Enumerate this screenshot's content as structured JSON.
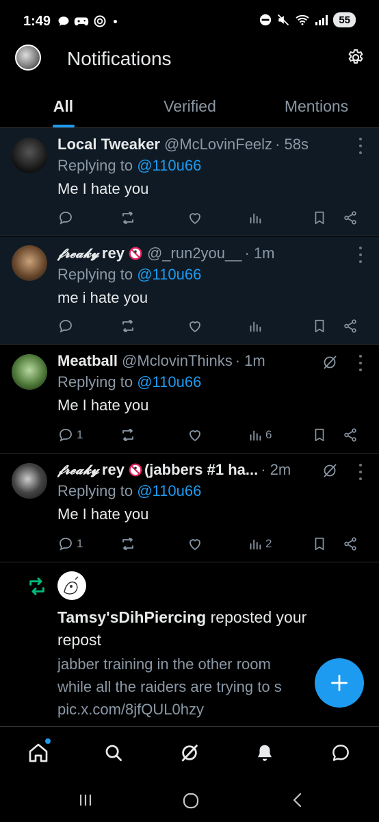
{
  "status_bar": {
    "time": "1:49",
    "battery": "55"
  },
  "header": {
    "title": "Notifications"
  },
  "tabs": [
    {
      "label": "All",
      "active": true
    },
    {
      "label": "Verified",
      "active": false
    },
    {
      "label": "Mentions",
      "active": false
    }
  ],
  "notifications": [
    {
      "name": "Local Tweaker",
      "handle": "@McLovinFeelz",
      "time": "· 58s",
      "replying_prefix": "Replying to",
      "replying_to": "@110u66",
      "text": "Me I hate you",
      "replies": "",
      "views": ""
    },
    {
      "name_styled": "𝓯𝓻𝓮𝓪𝓴𝔂",
      "name": "rey",
      "handle": "@_run2you__",
      "time": "· 1m",
      "replying_prefix": "Replying to",
      "replying_to": "@110u66",
      "text": "me i hate you",
      "replies": "",
      "views": ""
    },
    {
      "name": "Meatball",
      "handle": "@MclovinThinks",
      "time": "· 1m",
      "replying_prefix": "Replying to",
      "replying_to": "@110u66",
      "text": "Me I hate you",
      "replies": "1",
      "views": "6"
    },
    {
      "name_styled": "𝓯𝓻𝓮𝓪𝓴𝔂",
      "name": "rey",
      "handle": "(jabbers #1 ha...",
      "time": "· 2m",
      "replying_prefix": "Replying to",
      "replying_to": "@110u66",
      "text": "Me I hate you",
      "replies": "1",
      "views": "2"
    }
  ],
  "repost": {
    "user": "Tamsy'sDihPiercing",
    "action": "reposted your repost",
    "quote_line1": "jabber training in the other room",
    "quote_line2": "while all the raiders are trying to s",
    "quote_line3": "pic.x.com/8jfQUL0hzy"
  },
  "colors": {
    "accent": "#1d9bf0",
    "repost_green": "#00ba7c",
    "muted": "#8b98a5",
    "unread_bg": "#0f1a24"
  }
}
